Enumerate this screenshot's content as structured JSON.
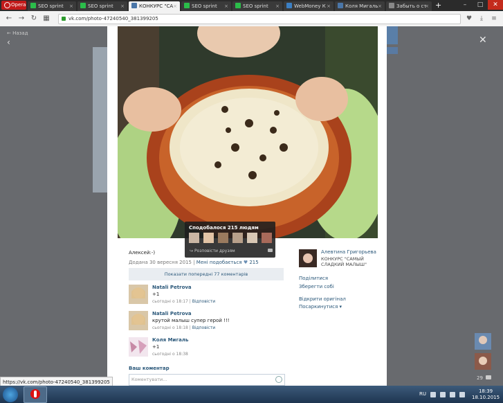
{
  "browser": {
    "menu_label": "Opera",
    "tabs": [
      {
        "label": "SEO sprint",
        "icon_color": "#2bbd4a",
        "active": false
      },
      {
        "label": "SEO sprint",
        "icon_color": "#2bbd4a",
        "active": false
      },
      {
        "label": "КОНКУРС \"СА",
        "icon_color": "#4a76a8",
        "active": true
      },
      {
        "label": "SEO sprint",
        "icon_color": "#2bbd4a",
        "active": false
      },
      {
        "label": "SEO sprint",
        "icon_color": "#2bbd4a",
        "active": false
      },
      {
        "label": "WebMoney К",
        "icon_color": "#3b7fc4",
        "active": false
      },
      {
        "label": "Коля Мигаль",
        "icon_color": "#4a76a8",
        "active": false
      },
      {
        "label": "Забыть о ст",
        "icon_color": "#888888",
        "active": false
      }
    ],
    "new_tab": "+",
    "url": "vk.com/photo-47240540_381399205",
    "status_url": "https://vk.com/photo-47240540_381399205"
  },
  "page": {
    "back_link": "Назад"
  },
  "likes_popup": {
    "title": "Сподобалося 215 людям",
    "share": "Розповісти друзям"
  },
  "photo_info": {
    "caption": "Алексей:-)",
    "date": "Додана 30 вересня 2015",
    "like_label": "Мені подобається",
    "like_count": "215",
    "show_previous": "Показати попередні 77 коментарів"
  },
  "comments": [
    {
      "name": "Natali Petrova",
      "text": "+1",
      "time": "сьогодні о 18:17",
      "reply": "Відповісти"
    },
    {
      "name": "Natali Petrova",
      "text": "крутой малыш супер герой !!!",
      "time": "сьогодні о 18:18",
      "reply": "Відповісти"
    },
    {
      "name": "Коля Мигаль",
      "text": "+1",
      "time": "сьогодні о 18:38",
      "reply": ""
    }
  ],
  "comment_form": {
    "title": "Ваш коментар",
    "placeholder": "Коментувати..."
  },
  "owner": {
    "name": "Алевтина Григорьева",
    "album": "КОНКУРС \"САМЫЙ СЛАДКИЙ МАЛЫШ\""
  },
  "actions": {
    "share": "Поділитися",
    "save": "Зберегти собі",
    "open_original": "Відкрити оригінал",
    "more": "Посаркинутися ▾"
  },
  "chat": {
    "count": "29"
  },
  "taskbar": {
    "lang": "RU",
    "time": "18:39",
    "date": "18.10.2015"
  },
  "colors": {
    "vk_link": "#2b587a",
    "tab_bar": "#2b2b2b",
    "opera_red": "#c21a1a",
    "taskbar": "#1e3550"
  }
}
